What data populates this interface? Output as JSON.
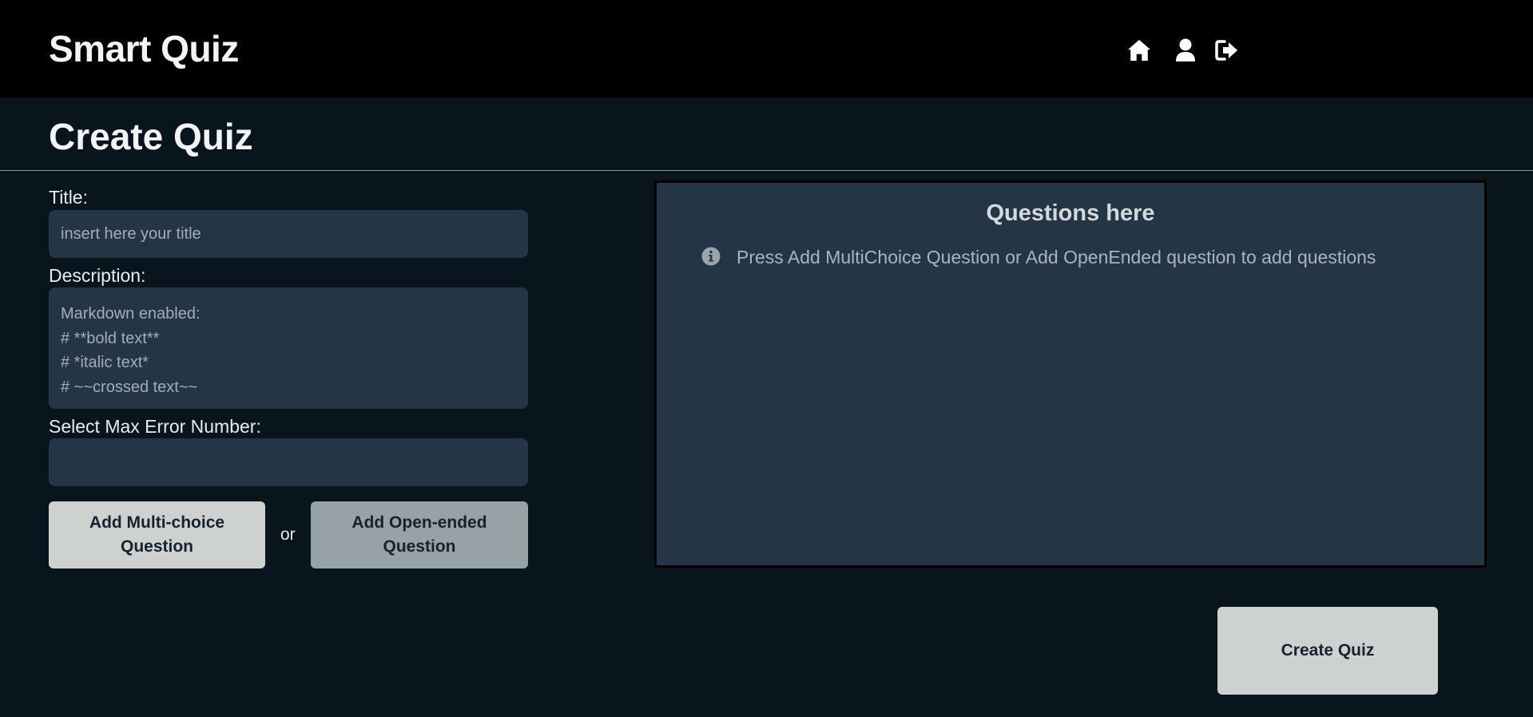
{
  "navbar": {
    "brand": "Smart Quiz",
    "icons": [
      "home-icon",
      "user-icon",
      "logout-icon"
    ]
  },
  "page": {
    "title": "Create Quiz"
  },
  "form": {
    "title_label": "Title:",
    "title_placeholder": "insert here your title",
    "title_value": "",
    "description_label": "Description:",
    "description_placeholder": "Markdown enabled:\n# **bold text**\n# *italic text*\n# ~~crossed text~~",
    "description_value": "",
    "max_error_label": "Select Max Error Number:",
    "max_error_value": ""
  },
  "actions": {
    "add_multichoice": "Add Multi-choice Question",
    "or": "or",
    "add_openended": "Add Open-ended Question",
    "create_quiz": "Create Quiz"
  },
  "questions": {
    "title": "Questions here",
    "info_icon": "info-circle-icon",
    "info_text": "Press Add MultiChoice Question or Add OpenEnded question to add questions"
  },
  "colors": {
    "background": "#08151d",
    "navbar": "#000000",
    "field": "#243646",
    "button_light": "#cdd1cf",
    "button_muted": "#97a2a7"
  }
}
